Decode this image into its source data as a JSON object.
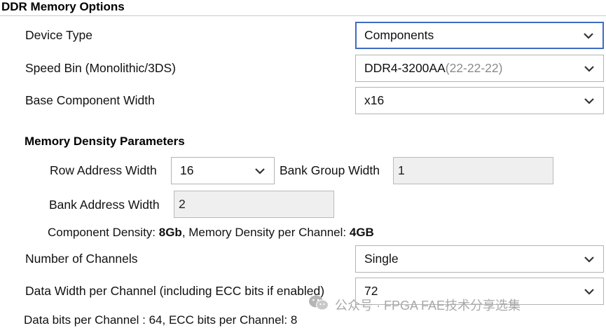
{
  "section": {
    "title": "DDR Memory Options"
  },
  "device_type": {
    "label": "Device Type",
    "value": "Components"
  },
  "speed_bin": {
    "label": "Speed Bin (Monolithic/3DS)",
    "value": "DDR4-3200AA",
    "timing": "(22-22-22)"
  },
  "base_width": {
    "label": "Base Component Width",
    "value": "x16"
  },
  "density": {
    "title": "Memory Density Parameters",
    "row_label": "Row Address Width",
    "row_value": "16",
    "bank_group_label": "Bank Group Width",
    "bank_group_value": "1",
    "bank_addr_label": "Bank Address Width",
    "bank_addr_value": "2",
    "comp_density_label": "Component Density: ",
    "comp_density_value": "8Gb",
    "mem_density_label": ", Memory Density per Channel: ",
    "mem_density_value": "4GB"
  },
  "channels": {
    "label": "Number of Channels",
    "value": "Single"
  },
  "data_width": {
    "label": "Data Width per Channel (including ECC bits if enabled)",
    "value": "72"
  },
  "footer": {
    "text": "Data bits per Channel : 64, ECC bits per Channel: 8"
  },
  "watermark": {
    "text": "公众号 · FPGA FAE技术分享选集",
    "icon": "wechat-icon"
  },
  "colors": {
    "focus": "#3f6cc0",
    "readonly_bg": "#efefef"
  }
}
